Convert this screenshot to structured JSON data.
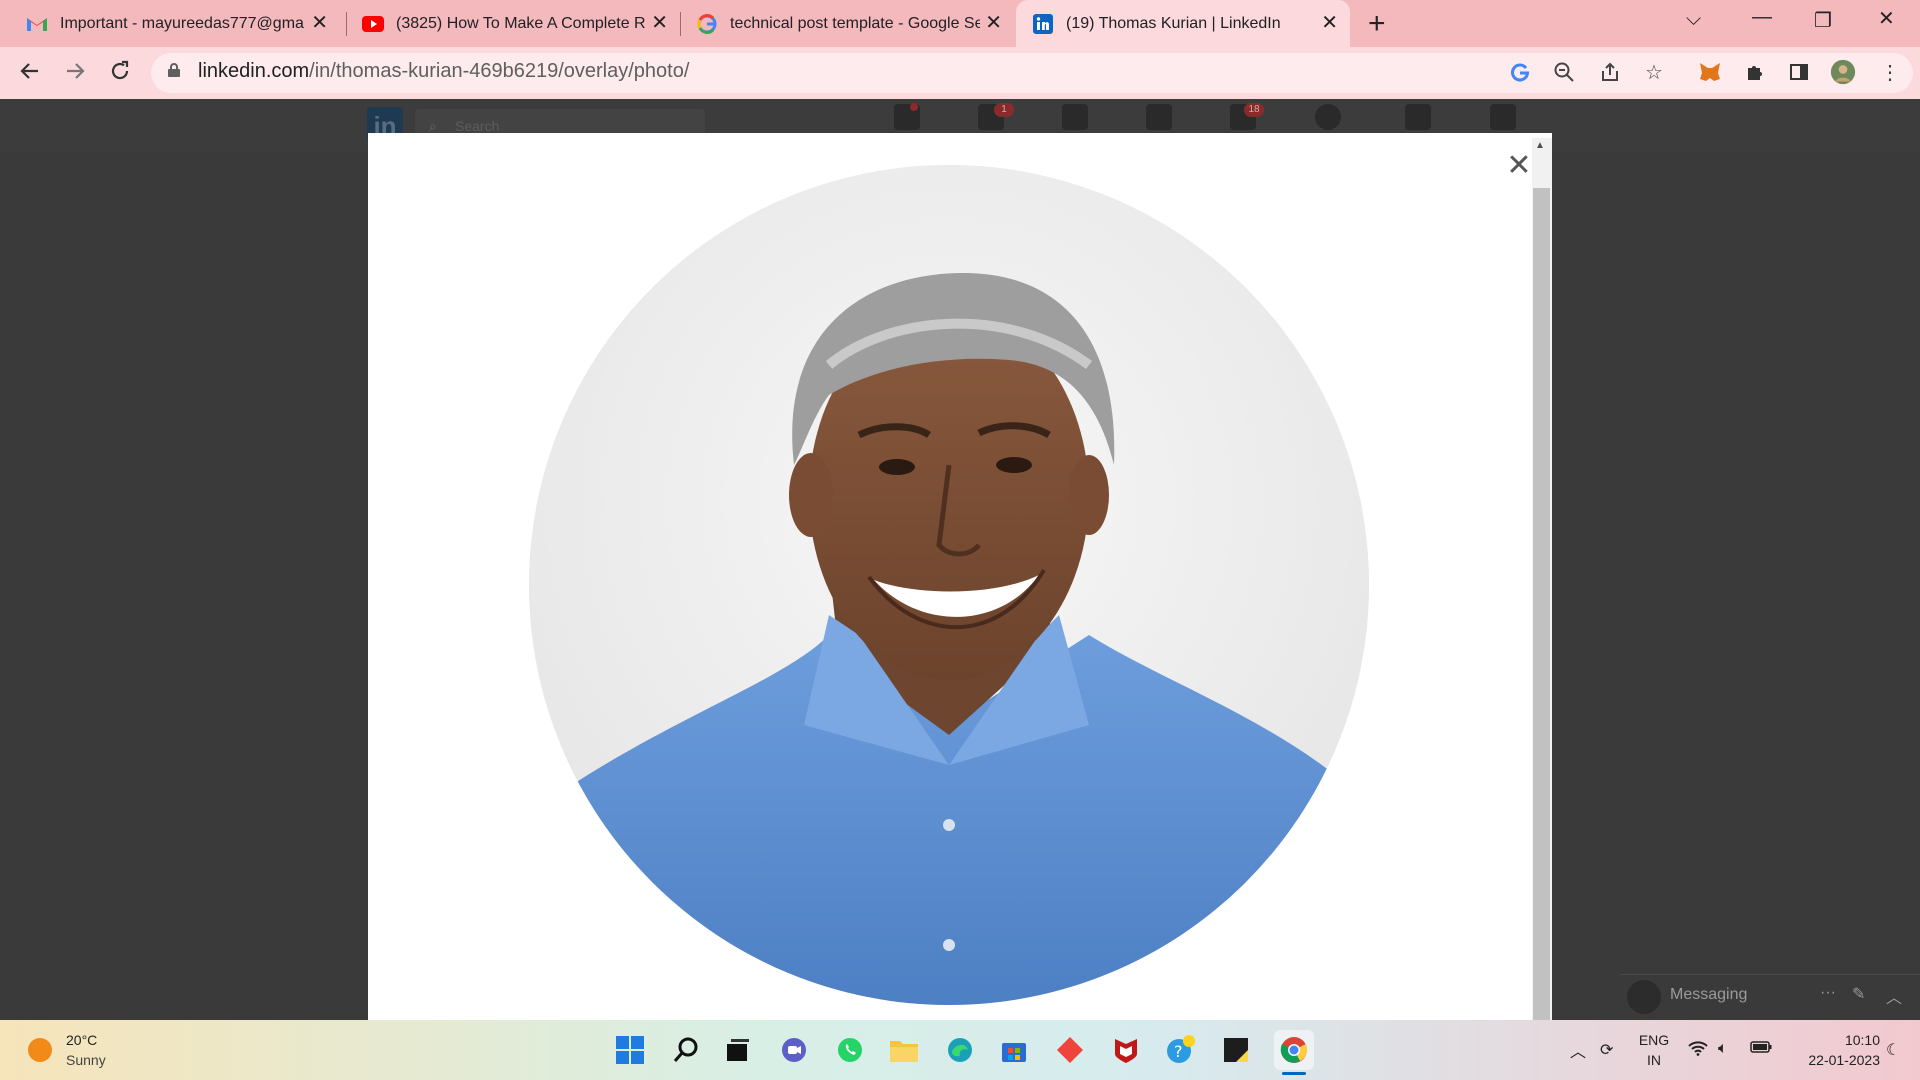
{
  "browser": {
    "tabs": [
      {
        "title": "Important - mayureedas777@gmail.com",
        "icon": "gmail-icon",
        "active": false
      },
      {
        "title": "(3825) How To Make A Complete Re",
        "icon": "youtube-icon",
        "active": false
      },
      {
        "title": "technical post template - Google Se",
        "icon": "google-icon",
        "active": false
      },
      {
        "title": "(19) Thomas Kurian | LinkedIn",
        "icon": "linkedin-icon",
        "active": true
      }
    ],
    "url_host": "linkedin.com",
    "url_path": "/in/thomas-kurian-469b6219/overlay/photo/"
  },
  "linkedin": {
    "search_placeholder": "Search",
    "badges": {
      "home": "",
      "network": "1",
      "notifications": "18"
    },
    "messaging_label": "Messaging",
    "messaging_more": "···"
  },
  "modal": {
    "close_label": "✕"
  },
  "taskbar": {
    "temperature": "20°C",
    "weather": "Sunny",
    "lang_top": "ENG",
    "lang_bottom": "IN",
    "time": "10:10",
    "date": "22-01-2023"
  },
  "colors": {
    "tabbar": "#f3b9bd",
    "toolbar": "#fbd9dc",
    "overlay_bg": "#3a3a3a",
    "shirt_blue": "#5f8fd2"
  }
}
